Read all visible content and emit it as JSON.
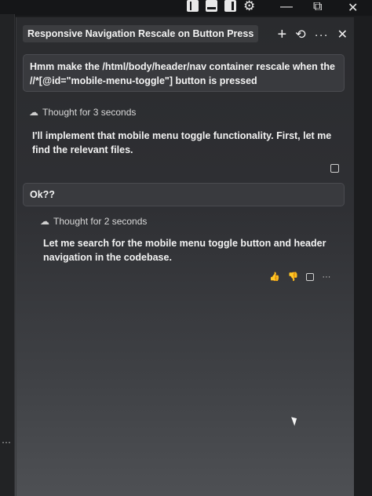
{
  "window": {
    "minimize_label": "—",
    "maximize_label": "⧉",
    "close_label": "✕"
  },
  "panel": {
    "title": "Responsive Navigation Rescale on Button Press",
    "actions": {
      "new_chat": "+",
      "history": "⟲",
      "more": "···",
      "close": "✕"
    }
  },
  "messages": [
    {
      "role": "user",
      "text": "Hmm make the  /html/body/header/nav  container rescale when the //*[@id=\"mobile-menu-toggle\"] button is pressed"
    },
    {
      "role": "thought",
      "text": "Thought for 3 seconds"
    },
    {
      "role": "assistant",
      "text": "I'll implement that mobile menu toggle functionality. First, let me find the relevant files."
    },
    {
      "role": "user",
      "text": "Ok??"
    },
    {
      "role": "thought",
      "text": "Thought for 2 seconds"
    },
    {
      "role": "assistant",
      "text": "Let me search for the mobile menu toggle button and header navigation in the codebase."
    }
  ],
  "feedback": {
    "thumbs_up": "👍",
    "thumbs_down": "👎",
    "more": "···"
  },
  "bottom_controls": {
    "more": "···",
    "up": "⌃",
    "close": "✕"
  },
  "icons": {
    "thought": "brain-icon",
    "gear": "gear-icon"
  }
}
